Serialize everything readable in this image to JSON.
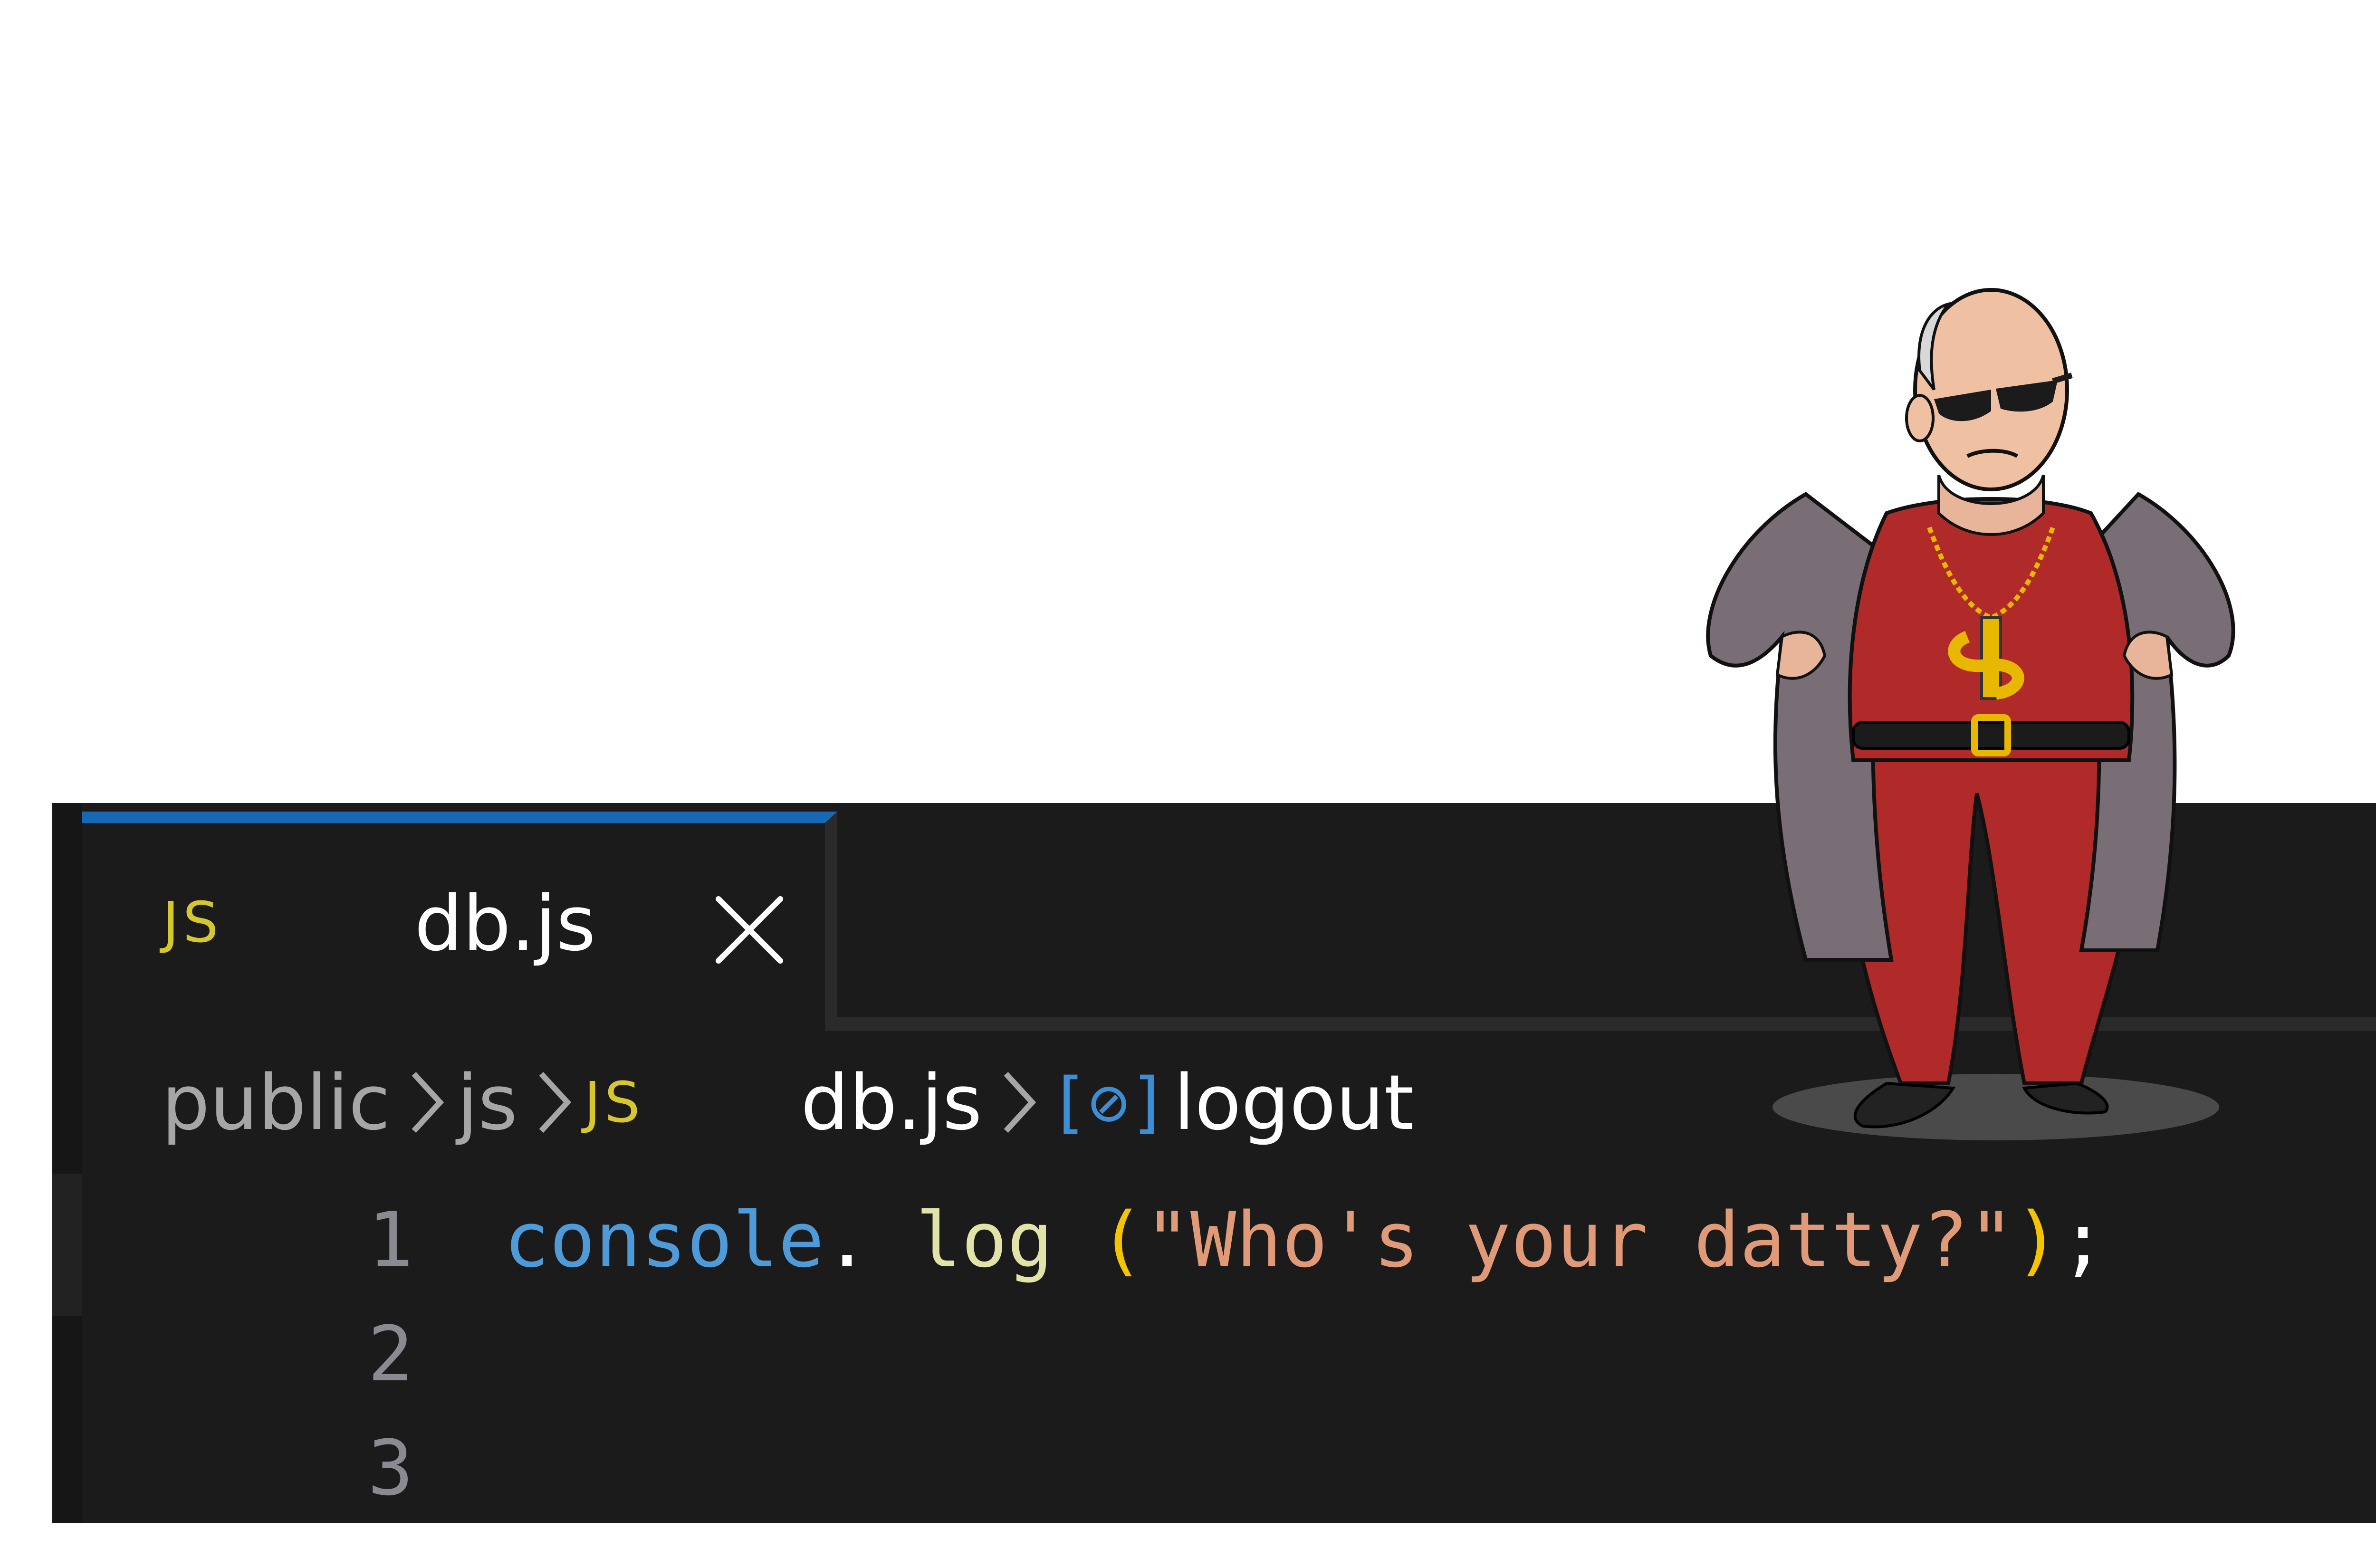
{
  "tab": {
    "icon": "JS",
    "label": "db.js",
    "close_icon": "close-icon"
  },
  "breadcrumb": {
    "items": [
      "public",
      "js"
    ],
    "file_icon": "JS",
    "file": "db.js",
    "symbol_icon": "[⊘]",
    "symbol": "logout"
  },
  "editor": {
    "line_numbers": [
      "1",
      "2",
      "3"
    ],
    "code": {
      "object": "console",
      "dot": ".",
      "method": " log ",
      "open_paren": "(",
      "string": "\"Who's your datty?\"",
      "close_paren": ")",
      "semicolon": ";"
    }
  },
  "colors": {
    "editor_bg": "#1b1b1b",
    "tab_accent": "#1769b6",
    "js_icon": "#d7c72f",
    "string": "#e09a78",
    "keyword_object": "#4f9ad8",
    "method": "#e2e3a9",
    "paren": "#f5c400"
  },
  "illustration": {
    "name": "cartoon-bald-man-red-suit-sunglasses"
  }
}
